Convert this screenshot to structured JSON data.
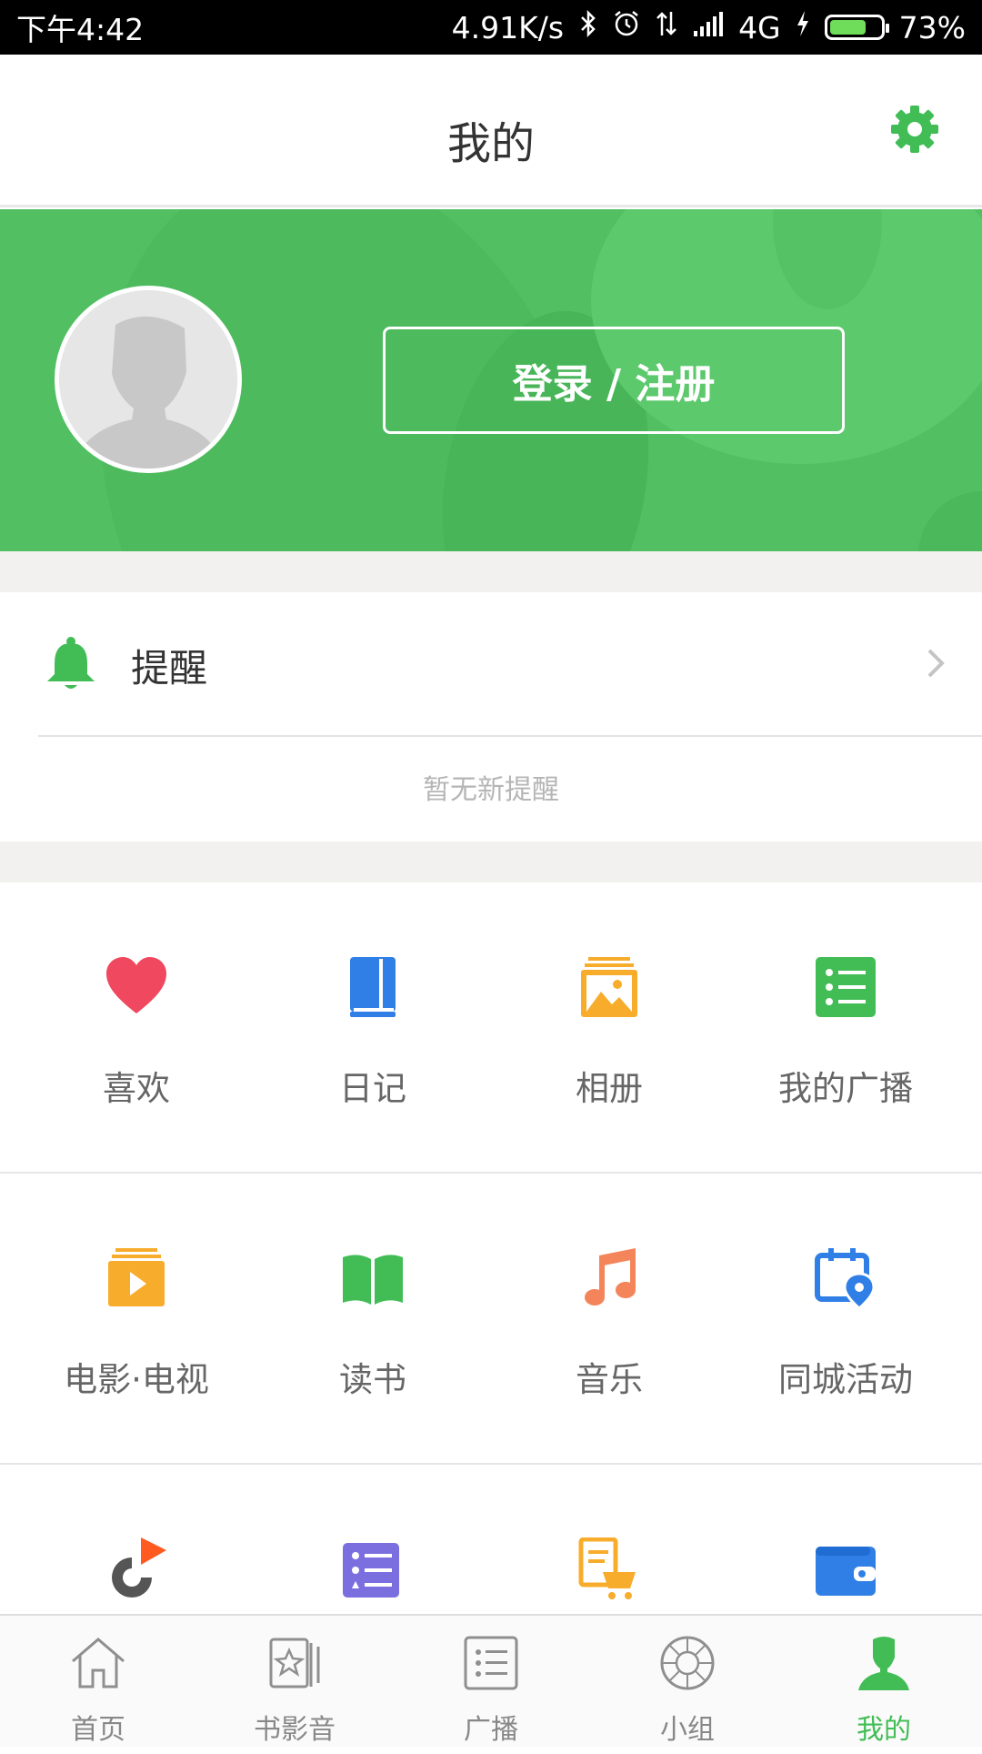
{
  "status_bar": {
    "time": "下午4:42",
    "network_speed": "4.91K/s",
    "network_type": "4G",
    "battery": "73%",
    "battery_level": 0.73
  },
  "header": {
    "title": "我的",
    "settings_icon": "gear-icon"
  },
  "profile": {
    "login_label": "登录 / 注册",
    "avatar_icon": "default-avatar-icon"
  },
  "reminder": {
    "label": "提醒",
    "empty_text": "暂无新提醒"
  },
  "grid": {
    "items": [
      {
        "label": "喜欢",
        "icon": "heart-icon",
        "color": "#f0485e"
      },
      {
        "label": "日记",
        "icon": "diary-icon",
        "color": "#2f7fe6"
      },
      {
        "label": "相册",
        "icon": "album-icon",
        "color": "#f8ac2c"
      },
      {
        "label": "我的广播",
        "icon": "broadcast-list-icon",
        "color": "#42bd56"
      },
      {
        "label": "电影·电视",
        "icon": "movie-tv-icon",
        "color": "#f8ac2c"
      },
      {
        "label": "读书",
        "icon": "book-icon",
        "color": "#42bd56"
      },
      {
        "label": "音乐",
        "icon": "music-note-icon",
        "color": "#f4845a"
      },
      {
        "label": "同城活动",
        "icon": "calendar-location-icon",
        "color": "#2f7fe6"
      },
      {
        "label": "",
        "icon": "play-circle-icon",
        "color": "#ff5a1f"
      },
      {
        "label": "",
        "icon": "list-icon",
        "color": "#7b6fe0"
      },
      {
        "label": "",
        "icon": "order-cart-icon",
        "color": "#f8ac2c"
      },
      {
        "label": "",
        "icon": "wallet-icon",
        "color": "#2f7fe6"
      }
    ]
  },
  "bottom_nav": {
    "items": [
      {
        "label": "首页",
        "icon": "home-icon",
        "active": false
      },
      {
        "label": "书影音",
        "icon": "book-movie-music-icon",
        "active": false
      },
      {
        "label": "广播",
        "icon": "broadcast-icon",
        "active": false
      },
      {
        "label": "小组",
        "icon": "group-icon",
        "active": false
      },
      {
        "label": "我的",
        "icon": "user-icon",
        "active": true
      }
    ]
  },
  "colors": {
    "brand_green": "#42bd56",
    "banner_green": "#52c062",
    "separator": "#f2f1ef"
  }
}
